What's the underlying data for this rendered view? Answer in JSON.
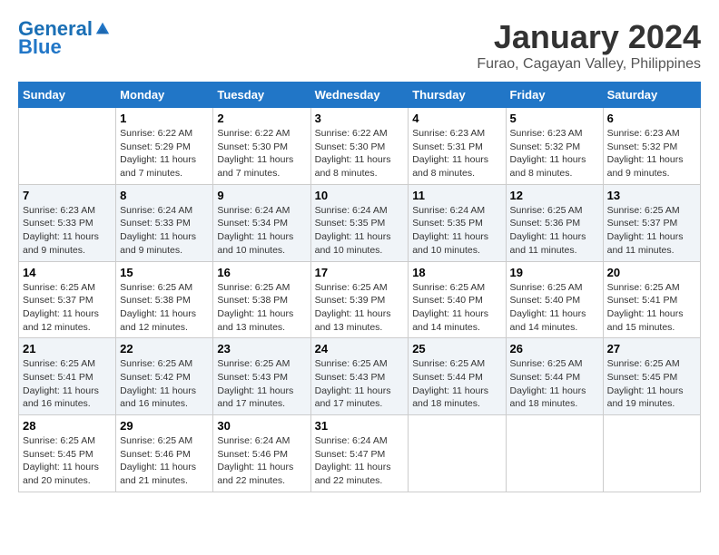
{
  "logo": {
    "line1": "General",
    "line2": "Blue"
  },
  "title": "January 2024",
  "location": "Furao, Cagayan Valley, Philippines",
  "days_of_week": [
    "Sunday",
    "Monday",
    "Tuesday",
    "Wednesday",
    "Thursday",
    "Friday",
    "Saturday"
  ],
  "weeks": [
    [
      {
        "day": "",
        "info": ""
      },
      {
        "day": "1",
        "info": "Sunrise: 6:22 AM\nSunset: 5:29 PM\nDaylight: 11 hours\nand 7 minutes."
      },
      {
        "day": "2",
        "info": "Sunrise: 6:22 AM\nSunset: 5:30 PM\nDaylight: 11 hours\nand 7 minutes."
      },
      {
        "day": "3",
        "info": "Sunrise: 6:22 AM\nSunset: 5:30 PM\nDaylight: 11 hours\nand 8 minutes."
      },
      {
        "day": "4",
        "info": "Sunrise: 6:23 AM\nSunset: 5:31 PM\nDaylight: 11 hours\nand 8 minutes."
      },
      {
        "day": "5",
        "info": "Sunrise: 6:23 AM\nSunset: 5:32 PM\nDaylight: 11 hours\nand 8 minutes."
      },
      {
        "day": "6",
        "info": "Sunrise: 6:23 AM\nSunset: 5:32 PM\nDaylight: 11 hours\nand 9 minutes."
      }
    ],
    [
      {
        "day": "7",
        "info": "Sunrise: 6:23 AM\nSunset: 5:33 PM\nDaylight: 11 hours\nand 9 minutes."
      },
      {
        "day": "8",
        "info": "Sunrise: 6:24 AM\nSunset: 5:33 PM\nDaylight: 11 hours\nand 9 minutes."
      },
      {
        "day": "9",
        "info": "Sunrise: 6:24 AM\nSunset: 5:34 PM\nDaylight: 11 hours\nand 10 minutes."
      },
      {
        "day": "10",
        "info": "Sunrise: 6:24 AM\nSunset: 5:35 PM\nDaylight: 11 hours\nand 10 minutes."
      },
      {
        "day": "11",
        "info": "Sunrise: 6:24 AM\nSunset: 5:35 PM\nDaylight: 11 hours\nand 10 minutes."
      },
      {
        "day": "12",
        "info": "Sunrise: 6:25 AM\nSunset: 5:36 PM\nDaylight: 11 hours\nand 11 minutes."
      },
      {
        "day": "13",
        "info": "Sunrise: 6:25 AM\nSunset: 5:37 PM\nDaylight: 11 hours\nand 11 minutes."
      }
    ],
    [
      {
        "day": "14",
        "info": "Sunrise: 6:25 AM\nSunset: 5:37 PM\nDaylight: 11 hours\nand 12 minutes."
      },
      {
        "day": "15",
        "info": "Sunrise: 6:25 AM\nSunset: 5:38 PM\nDaylight: 11 hours\nand 12 minutes."
      },
      {
        "day": "16",
        "info": "Sunrise: 6:25 AM\nSunset: 5:38 PM\nDaylight: 11 hours\nand 13 minutes."
      },
      {
        "day": "17",
        "info": "Sunrise: 6:25 AM\nSunset: 5:39 PM\nDaylight: 11 hours\nand 13 minutes."
      },
      {
        "day": "18",
        "info": "Sunrise: 6:25 AM\nSunset: 5:40 PM\nDaylight: 11 hours\nand 14 minutes."
      },
      {
        "day": "19",
        "info": "Sunrise: 6:25 AM\nSunset: 5:40 PM\nDaylight: 11 hours\nand 14 minutes."
      },
      {
        "day": "20",
        "info": "Sunrise: 6:25 AM\nSunset: 5:41 PM\nDaylight: 11 hours\nand 15 minutes."
      }
    ],
    [
      {
        "day": "21",
        "info": "Sunrise: 6:25 AM\nSunset: 5:41 PM\nDaylight: 11 hours\nand 16 minutes."
      },
      {
        "day": "22",
        "info": "Sunrise: 6:25 AM\nSunset: 5:42 PM\nDaylight: 11 hours\nand 16 minutes."
      },
      {
        "day": "23",
        "info": "Sunrise: 6:25 AM\nSunset: 5:43 PM\nDaylight: 11 hours\nand 17 minutes."
      },
      {
        "day": "24",
        "info": "Sunrise: 6:25 AM\nSunset: 5:43 PM\nDaylight: 11 hours\nand 17 minutes."
      },
      {
        "day": "25",
        "info": "Sunrise: 6:25 AM\nSunset: 5:44 PM\nDaylight: 11 hours\nand 18 minutes."
      },
      {
        "day": "26",
        "info": "Sunrise: 6:25 AM\nSunset: 5:44 PM\nDaylight: 11 hours\nand 18 minutes."
      },
      {
        "day": "27",
        "info": "Sunrise: 6:25 AM\nSunset: 5:45 PM\nDaylight: 11 hours\nand 19 minutes."
      }
    ],
    [
      {
        "day": "28",
        "info": "Sunrise: 6:25 AM\nSunset: 5:45 PM\nDaylight: 11 hours\nand 20 minutes."
      },
      {
        "day": "29",
        "info": "Sunrise: 6:25 AM\nSunset: 5:46 PM\nDaylight: 11 hours\nand 21 minutes."
      },
      {
        "day": "30",
        "info": "Sunrise: 6:24 AM\nSunset: 5:46 PM\nDaylight: 11 hours\nand 22 minutes."
      },
      {
        "day": "31",
        "info": "Sunrise: 6:24 AM\nSunset: 5:47 PM\nDaylight: 11 hours\nand 22 minutes."
      },
      {
        "day": "",
        "info": ""
      },
      {
        "day": "",
        "info": ""
      },
      {
        "day": "",
        "info": ""
      }
    ]
  ]
}
